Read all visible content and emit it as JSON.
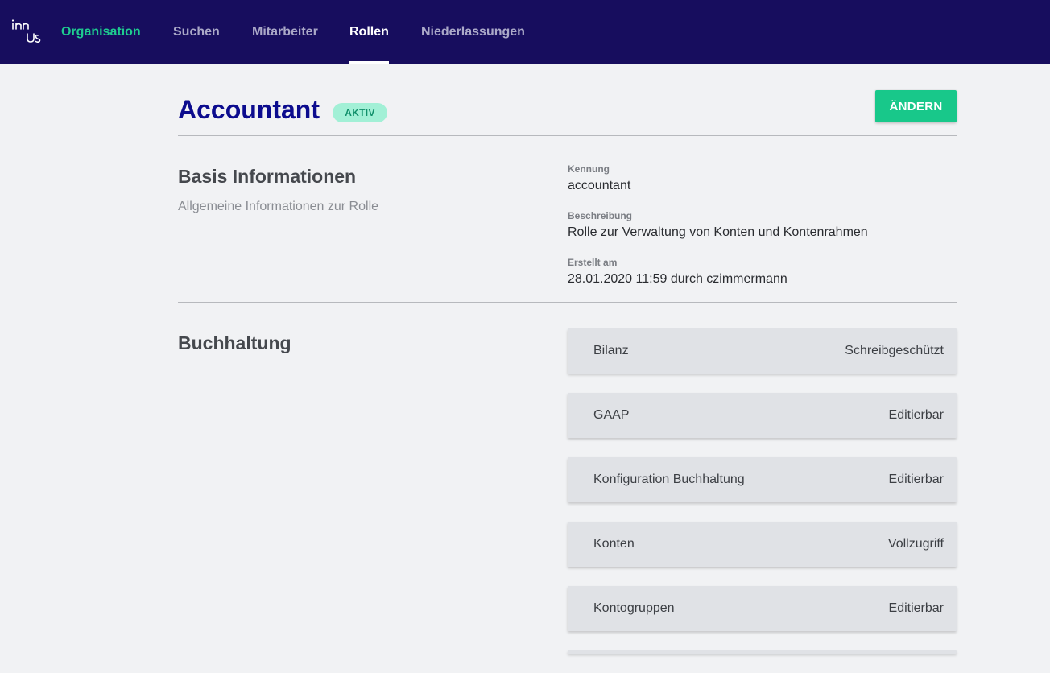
{
  "nav": {
    "items": [
      {
        "label": "Organisation"
      },
      {
        "label": "Suchen"
      },
      {
        "label": "Mitarbeiter"
      },
      {
        "label": "Rollen"
      },
      {
        "label": "Niederlassungen"
      }
    ]
  },
  "header": {
    "title": "Accountant",
    "status": "AKTIV",
    "edit_label": "ÄNDERN"
  },
  "basis": {
    "title": "Basis Informationen",
    "description": "Allgemeine Informationen zur Rolle",
    "fields": [
      {
        "label": "Kennung",
        "value": "accountant"
      },
      {
        "label": "Beschreibung",
        "value": "Rolle zur Verwaltung von Konten und Kontenrahmen"
      },
      {
        "label": "Erstellt am",
        "value": "28.01.2020 11:59 durch czimmermann"
      }
    ]
  },
  "buchhaltung": {
    "title": "Buchhaltung",
    "permissions": [
      {
        "name": "Bilanz",
        "access": "Schreibgeschützt"
      },
      {
        "name": "GAAP",
        "access": "Editierbar"
      },
      {
        "name": "Konfiguration Buchhaltung",
        "access": "Editierbar"
      },
      {
        "name": "Konten",
        "access": "Vollzugriff"
      },
      {
        "name": "Kontogruppen",
        "access": "Editierbar"
      }
    ]
  },
  "colors": {
    "nav_bg": "#170d5e",
    "brand_green": "#1ecb8f",
    "title_blue": "#0c0c8e",
    "button_green": "#18c88a"
  }
}
